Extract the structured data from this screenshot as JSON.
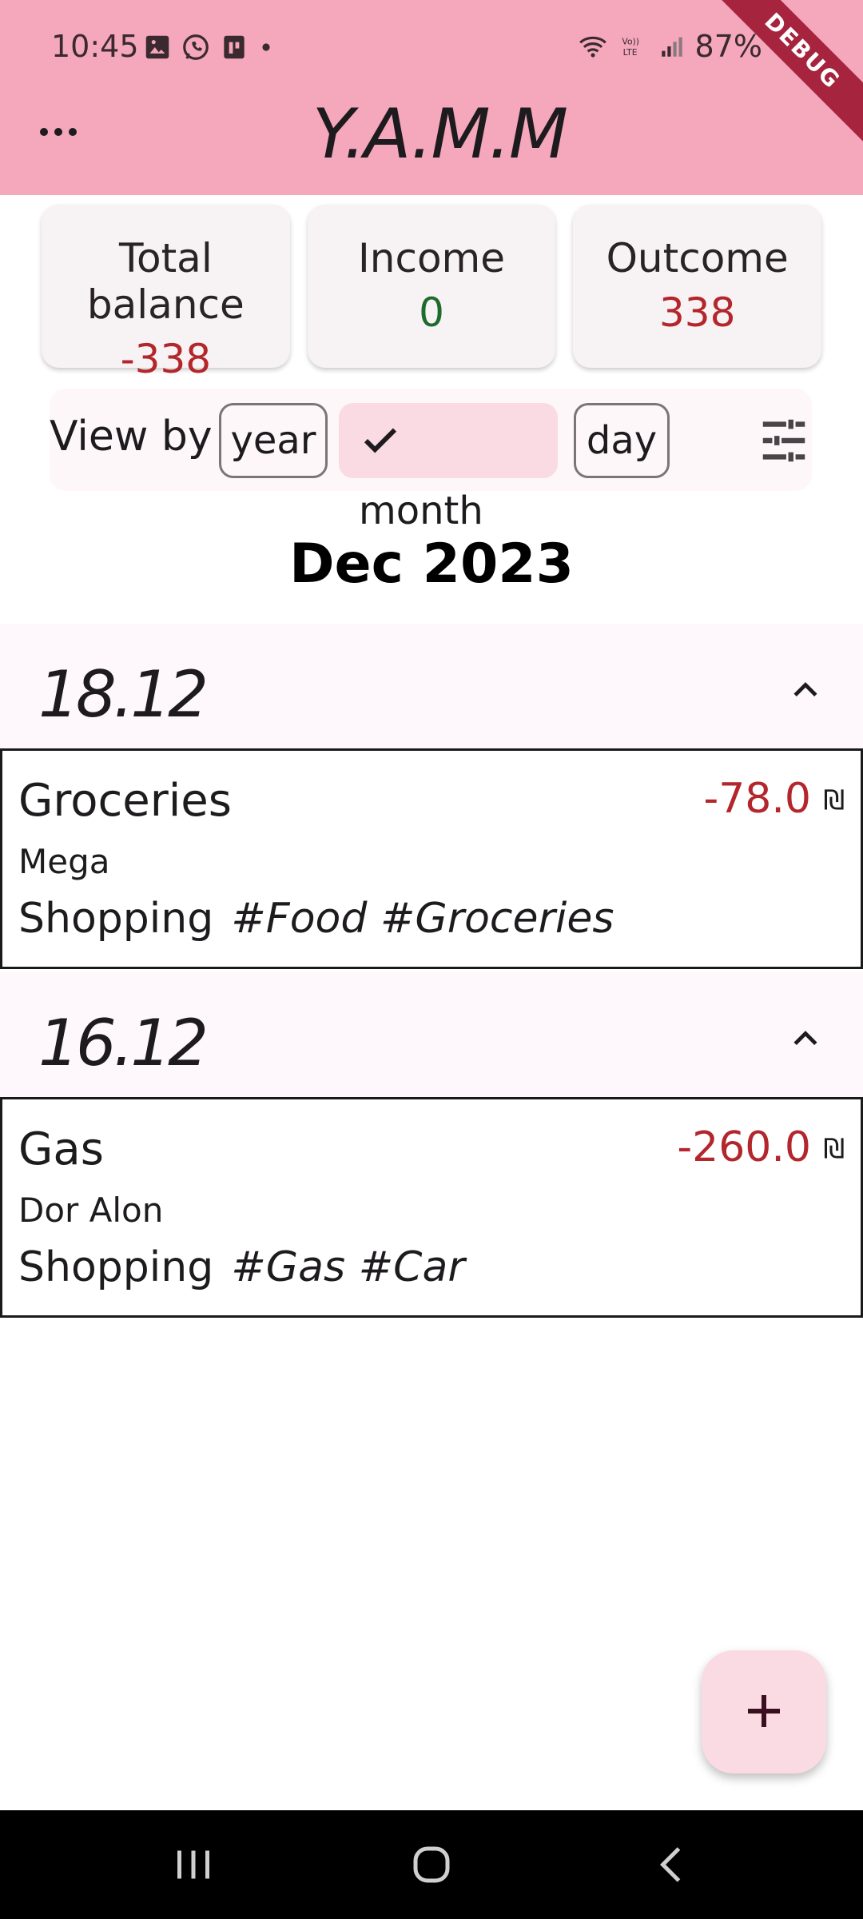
{
  "status_bar": {
    "time": "10:45",
    "battery": "87%",
    "icons_left": [
      "gallery-icon",
      "whatsapp-icon",
      "sim-icon",
      "dot-icon"
    ],
    "icons_right": [
      "wifi-icon",
      "volte-icon",
      "signal-icon",
      "battery-icon"
    ]
  },
  "debug_banner": "DEBUG",
  "app_bar": {
    "title": "Y.A.M.M",
    "menu_icon": "more-horiz-icon"
  },
  "summary": {
    "total_balance": {
      "label": "Total balance",
      "value": "-338"
    },
    "income": {
      "label": "Income",
      "value": "0"
    },
    "outcome": {
      "label": "Outcome",
      "value": "338"
    }
  },
  "view_by": {
    "label": "View by",
    "options": [
      {
        "label": "year",
        "selected": false
      },
      {
        "label": "month",
        "selected": true
      },
      {
        "label": "day",
        "selected": false
      }
    ],
    "filter_icon": "tune-icon"
  },
  "period": "Dec 2023",
  "groups": [
    {
      "date": "18.12",
      "transactions": [
        {
          "title": "Groceries",
          "vendor": "Mega",
          "category": "Shopping",
          "tags": "#Food #Groceries",
          "amount": "-78.0",
          "currency": "₪"
        }
      ]
    },
    {
      "date": "16.12",
      "transactions": [
        {
          "title": "Gas",
          "vendor": "Dor Alon",
          "category": "Shopping",
          "tags": "#Gas #Car",
          "amount": "-260.0",
          "currency": "₪"
        }
      ]
    }
  ],
  "fab": {
    "icon": "add-icon"
  },
  "nav_bar": {
    "buttons": [
      "recents-icon",
      "home-icon",
      "back-icon"
    ]
  },
  "colors": {
    "app_bar": "#f5a7bc",
    "negative": "#b3262c",
    "positive": "#1f6b2b",
    "chip_selected": "#fbdbe3",
    "debug_ribbon": "#a6243d"
  }
}
